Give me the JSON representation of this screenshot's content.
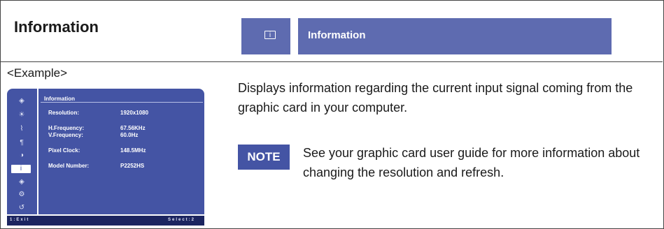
{
  "header": {
    "title": "Information",
    "menu_icon": "information-icon",
    "menu_icon_glyph": "i",
    "menu_label": "Information"
  },
  "example_label": "<Example>",
  "osd": {
    "title": "Information",
    "rows": [
      {
        "key": "Resolution:",
        "value": "1920x1080"
      },
      {
        "key": "H.Frequency:",
        "value": "67.56KHz"
      },
      {
        "key": "V.Frequency:",
        "value": "60.0Hz"
      },
      {
        "key": "Pixel Clock:",
        "value": "148.5MHz"
      },
      {
        "key": "Model Number:",
        "value": "P2252HS"
      }
    ],
    "icons": [
      {
        "name": "picture-adjust-icon",
        "glyph": "◈"
      },
      {
        "name": "brightness-icon",
        "glyph": "☀"
      },
      {
        "name": "color-adjust-icon",
        "glyph": "⌇"
      },
      {
        "name": "advanced-setup-icon",
        "glyph": "¶"
      },
      {
        "name": "input-select-icon",
        "glyph": "◑"
      },
      {
        "name": "information-icon",
        "glyph": "i"
      },
      {
        "name": "audio-icon",
        "glyph": "◈"
      },
      {
        "name": "setup-menu-icon",
        "glyph": "⚙"
      },
      {
        "name": "memory-recall-icon",
        "glyph": "↺"
      }
    ],
    "footer_left": "1:Exit",
    "footer_right": "Select:2"
  },
  "description": "Displays information regarding the current input signal coming from the graphic card in your computer.",
  "note": {
    "badge": "NOTE",
    "text": "See your graphic card user guide for more information about changing the resolution and refresh."
  },
  "colors": {
    "osd_blue": "#4454a4",
    "header_blue": "#5e6bb0",
    "osd_footer": "#1c2560"
  }
}
